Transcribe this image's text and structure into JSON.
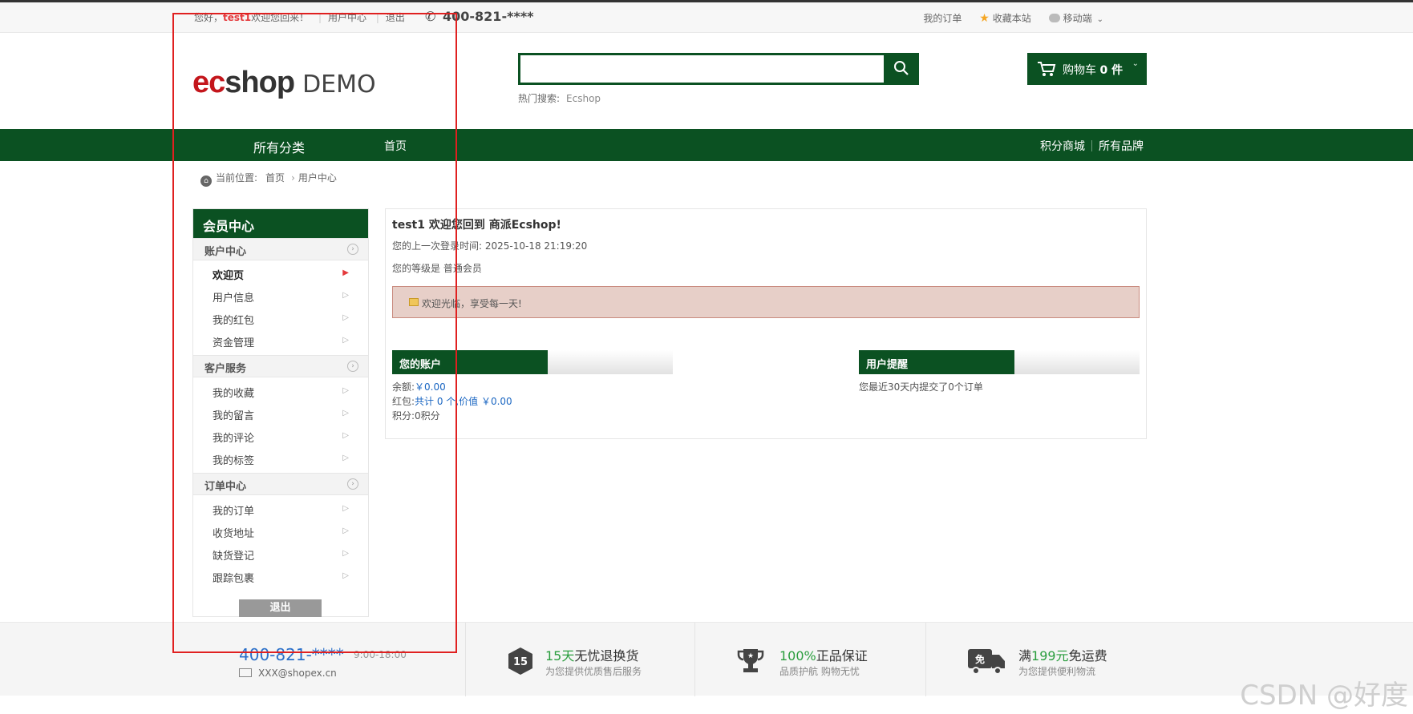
{
  "topbar": {
    "greeting": "您好，",
    "username": "test1",
    "welcome": "欢迎您回来！",
    "user_center": "用户中心",
    "logout": "退出",
    "phone": "400-821-****",
    "my_orders": "我的订单",
    "bookmark": "收藏本站",
    "mobile": "移动端"
  },
  "header": {
    "logo_ec": "ec",
    "logo_shop": "shop",
    "logo_demo": "DEMO",
    "search_value": "",
    "hot_label": "热门搜索:",
    "hot_keyword": "Ecshop",
    "cart_label": "购物车",
    "cart_count": "0 件"
  },
  "nav": {
    "all_categories": "所有分类",
    "home": "首页",
    "points_mall": "积分商城",
    "all_brands": "所有品牌"
  },
  "breadcrumb": {
    "label": "当前位置:",
    "home": "首页",
    "current": "用户中心"
  },
  "sidebar": {
    "title": "会员中心",
    "sections": [
      {
        "title": "账户中心",
        "items": [
          "欢迎页",
          "用户信息",
          "我的红包",
          "资金管理"
        ]
      },
      {
        "title": "客户服务",
        "items": [
          "我的收藏",
          "我的留言",
          "我的评论",
          "我的标签"
        ]
      },
      {
        "title": "订单中心",
        "items": [
          "我的订单",
          "收货地址",
          "缺货登记",
          "跟踪包裹"
        ]
      }
    ],
    "logout": "退出"
  },
  "main": {
    "welcome": "test1 欢迎您回到 商派Ecshop!",
    "last_login": "您的上一次登录时间: 2025-10-18 21:19:20",
    "level": "您的等级是 普通会员",
    "notice": "欢迎光临，享受每一天!",
    "account_title": "您的账户",
    "balance_label": "余额:",
    "balance_value": "￥0.00",
    "bonus_label": "红包:",
    "bonus_value": "共计 0 个,价值 ￥0.00",
    "points": "积分:0积分",
    "reminder_title": "用户提醒",
    "reminder_text": "您最近30天内提交了0个订单"
  },
  "footer": {
    "phone": "400-821-****",
    "hours": "9:00-18:00",
    "email": "XXX@shopex.cn",
    "features": [
      {
        "badge": "15",
        "highlight": "15天",
        "title_rest": "无忧退换货",
        "sub": "为您提供优质售后服务"
      },
      {
        "highlight": "100%",
        "title_rest": "正品保证",
        "sub": "品质护航 购物无忧"
      },
      {
        "badge": "免",
        "prefix": "满",
        "highlight": "199元",
        "title_rest": "免运费",
        "sub": "为您提供便利物流"
      }
    ]
  },
  "watermark": "CSDN @好度",
  "colors": {
    "brand_green": "#0b5122",
    "accent_red": "#e4393c",
    "link_blue": "#1a66c2",
    "annotation_red": "#e02020"
  },
  "icons": [
    "phone-icon",
    "star-icon",
    "wechat-icon",
    "search-icon",
    "cart-icon",
    "home-icon",
    "envelope-icon",
    "badge-15-icon",
    "trophy-icon",
    "truck-icon"
  ]
}
